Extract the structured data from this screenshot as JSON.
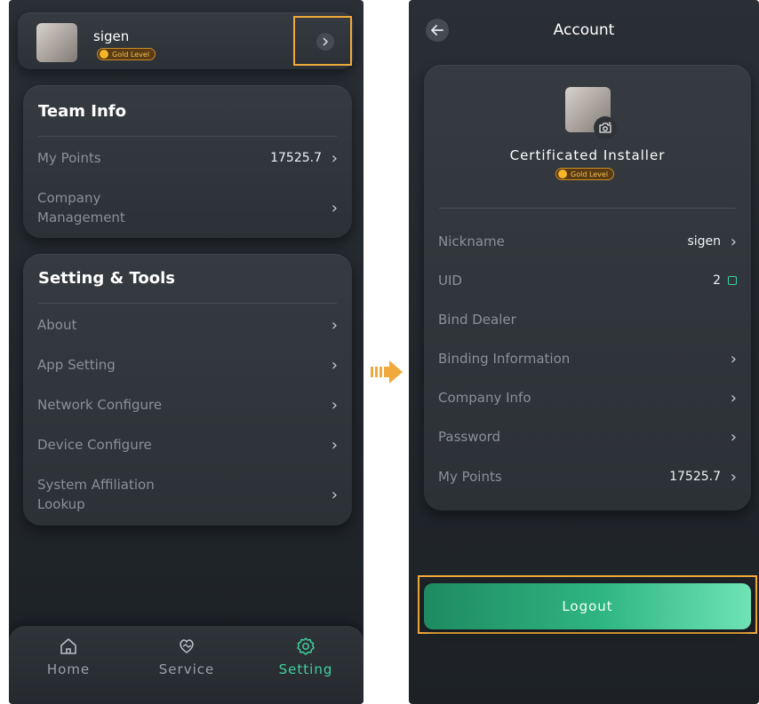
{
  "left_screen": {
    "profile": {
      "name": "sigen",
      "badge": "Gold Level"
    },
    "team_info": {
      "title": "Team Info",
      "items": [
        {
          "label": "My Points",
          "value": "17525.7"
        },
        {
          "label": "Company\nManagement",
          "value": ""
        }
      ]
    },
    "setting_tools": {
      "title": "Setting & Tools",
      "items": [
        {
          "label": "About"
        },
        {
          "label": "App Setting"
        },
        {
          "label": "Network Configure"
        },
        {
          "label": "Device Configure"
        },
        {
          "label": "System Affiliation\nLookup"
        }
      ]
    },
    "tabbar": {
      "tabs": [
        {
          "label": "Home",
          "icon": "home-icon",
          "active": false
        },
        {
          "label": "Service",
          "icon": "service-icon",
          "active": false
        },
        {
          "label": "Setting",
          "icon": "gear-icon",
          "active": true
        }
      ]
    }
  },
  "right_screen": {
    "header": {
      "title": "Account"
    },
    "profile": {
      "role": "Certificated Installer",
      "badge": "Gold Level"
    },
    "items": [
      {
        "label": "Nickname",
        "value": "sigen"
      },
      {
        "label": "UID",
        "value": "2"
      },
      {
        "label": "Bind Dealer",
        "value": ""
      },
      {
        "label": "Binding Information",
        "value": ""
      },
      {
        "label": "Company Info",
        "value": ""
      },
      {
        "label": "Password",
        "value": ""
      },
      {
        "label": "My Points",
        "value": "17525.7"
      }
    ],
    "logout_label": "Logout"
  },
  "colors": {
    "accent_green": "#3fd29d",
    "highlight_orange": "#f0a93b",
    "gold_badge": "#f5b62a"
  }
}
